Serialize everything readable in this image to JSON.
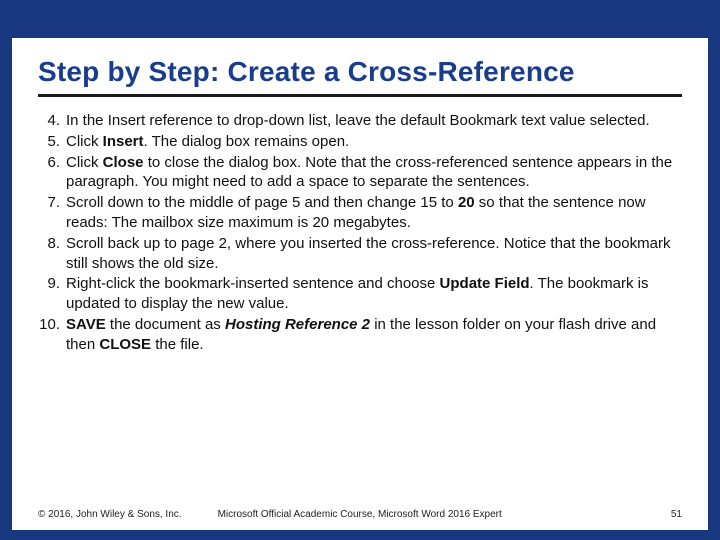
{
  "title": "Step by Step: Create a Cross-Reference",
  "steps": [
    {
      "num": "4.",
      "html": "In the Insert reference to drop-down list, leave the default Bookmark text value selected."
    },
    {
      "num": "5.",
      "html": "Click <b>Insert</b>. The dialog box remains open."
    },
    {
      "num": "6.",
      "html": "Click <b>Close</b> to close the dialog box. Note that the cross-referenced sentence appears in the paragraph. You might need to add a space to separate the sentences."
    },
    {
      "num": "7.",
      "html": "Scroll down to the middle of page 5 and then change 15 to <b>20</b> so that the sentence now reads: The mailbox size maximum is 20 megabytes."
    },
    {
      "num": "8.",
      "html": "Scroll back up to page 2, where you inserted the cross-reference. Notice that the bookmark still shows the old size."
    },
    {
      "num": "9.",
      "html": "Right-click the bookmark-inserted sentence and choose <b>Update Field</b>. The bookmark is updated to display the new value."
    },
    {
      "num": "10.",
      "html": "<b>SAVE</b> the document as <i class=\"bold\">Hosting Reference 2</i> in the lesson folder on your flash drive and then <b>CLOSE</b> the file."
    }
  ],
  "footer": {
    "copyright": "© 2016, John Wiley & Sons, Inc.",
    "course": "Microsoft Official Academic Course, Microsoft Word 2016 Expert",
    "page": "51"
  }
}
